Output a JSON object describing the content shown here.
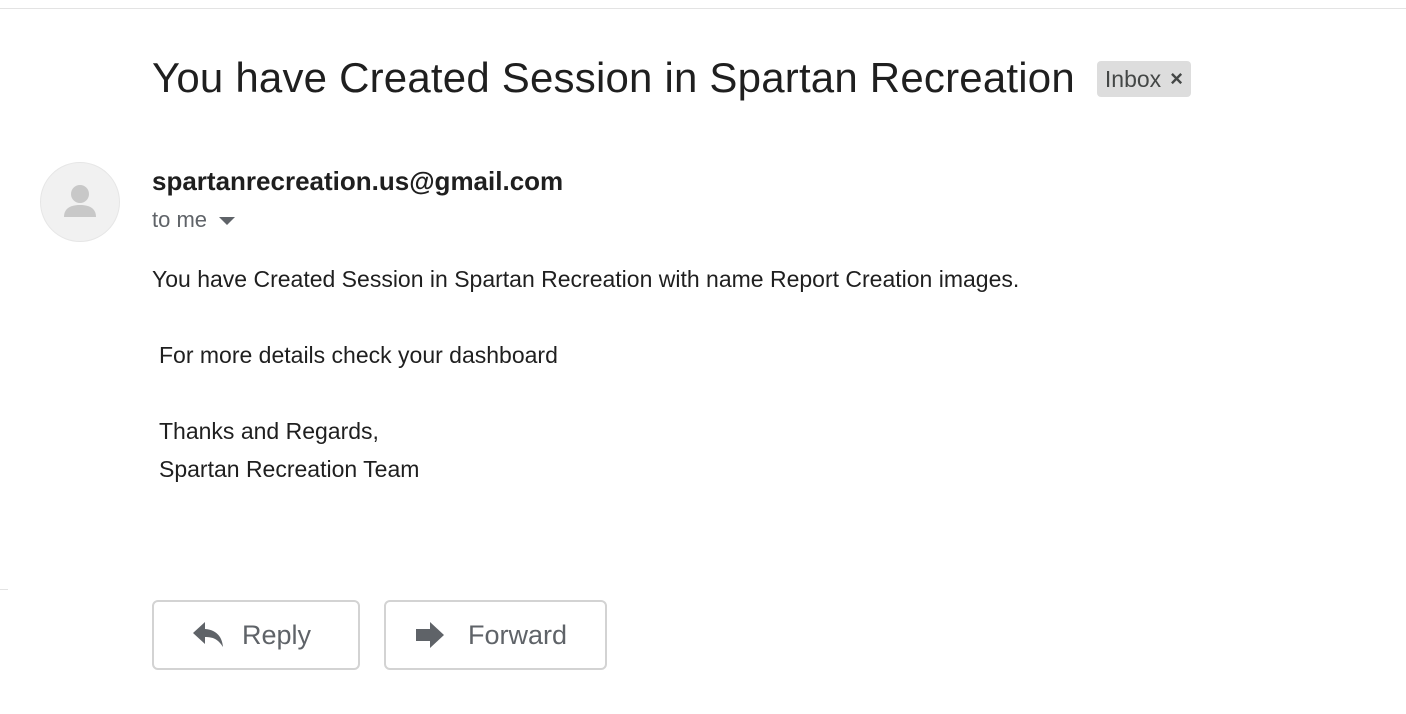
{
  "email": {
    "subject": "You have Created Session in Spartan Recreation",
    "label": "Inbox",
    "label_remove_glyph": "×",
    "sender": "spartanrecreation.us@gmail.com",
    "recipient": "to me",
    "body": {
      "line1": "You have Created Session in Spartan Recreation with name Report Creation images.",
      "line2": "For more details check your dashboard",
      "line3": "Thanks and Regards,",
      "line4": "Spartan Recreation Team"
    }
  },
  "actions": {
    "reply_label": "Reply",
    "forward_label": "Forward"
  },
  "icons": {
    "avatar": "person-icon",
    "recipient_details": "chevron-down-icon",
    "reply": "reply-icon",
    "forward": "forward-icon"
  },
  "colors": {
    "text_primary": "#1f1f1f",
    "text_secondary": "#5f6368",
    "chip_bg": "#dddddd",
    "button_border": "#d3d3d3",
    "avatar_bg": "#f1f1f1"
  }
}
